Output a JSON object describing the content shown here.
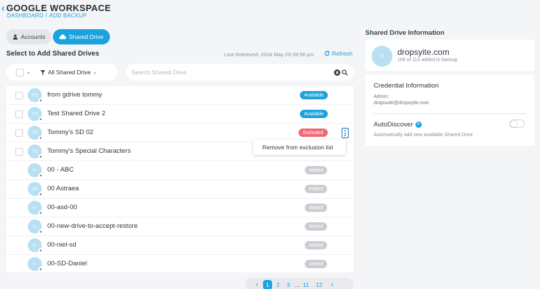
{
  "header": {
    "title": "GOOGLE WORKSPACE",
    "back_icon": "chevron-left-icon"
  },
  "breadcrumb": {
    "items": [
      "DASHBOARD",
      "ADD BACKUP"
    ],
    "separator": "/"
  },
  "tabs": [
    {
      "label": "Accounts",
      "icon": "person-icon",
      "active": false
    },
    {
      "label": "Shared Drive",
      "icon": "cloud-icon",
      "active": true
    }
  ],
  "main": {
    "section_title": "Select to Add Shared Drives",
    "last_retrieved": "Last Retrieved: 2024 May 29 08:58 pm",
    "refresh_label": "Refresh",
    "filter": {
      "label": "All Shared Drive"
    },
    "search": {
      "placeholder": "Search Shared Drive"
    }
  },
  "drives": [
    {
      "initials": "FG",
      "name": "from gdrive tommy",
      "status": "Available",
      "status_type": "available",
      "checkbox": true
    },
    {
      "initials": "TS",
      "name": "Test Shared Drive 2",
      "status": "Available",
      "status_type": "available",
      "checkbox": true
    },
    {
      "initials": "TS",
      "name": "Tommy's SD 02",
      "status": "Excluded",
      "status_type": "excluded",
      "checkbox": true
    },
    {
      "initials": "TS",
      "name": "Tommy's Special Characters",
      "status": "",
      "status_type": "",
      "checkbox": true
    },
    {
      "initials": "0-",
      "name": "00 - ABC",
      "status": "Added",
      "status_type": "added",
      "checkbox": false
    },
    {
      "initials": "0A",
      "name": "00 Astraea",
      "status": "Added",
      "status_type": "added",
      "checkbox": false
    },
    {
      "initials": "0-",
      "name": "00-asd-00",
      "status": "Added",
      "status_type": "added",
      "checkbox": false
    },
    {
      "initials": "0-",
      "name": "00-new-drive-to-accept-restore",
      "status": "Added",
      "status_type": "added",
      "checkbox": false
    },
    {
      "initials": "0-",
      "name": "00-niel-sd",
      "status": "Added",
      "status_type": "added",
      "checkbox": false
    },
    {
      "initials": "0-",
      "name": "00-SD-Daniel",
      "status": "Added",
      "status_type": "added",
      "checkbox": false
    }
  ],
  "popover": {
    "label": "Remove from exclusion list"
  },
  "pagination": {
    "prev": "‹",
    "pages": [
      "1",
      "2",
      "3",
      "...",
      "11",
      "12"
    ],
    "active": "1",
    "next": "›"
  },
  "panel": {
    "title": "Shared Drive Information",
    "avatar_initials": "D",
    "name": "dropsyite.com",
    "subtitle": "109 of 113 added to backup",
    "credential_title": "Credential Information",
    "admin_label": "Admin:",
    "admin_email": "dropsuite@dropsyite.com",
    "autodiscover_title": "AutoDiscover",
    "autodiscover_desc": "Automatically add new available Shared Drive",
    "autodiscover_on": false
  },
  "colors": {
    "accent": "#1ba3e0",
    "excluded": "#ef6a78",
    "added": "#c9ccd1"
  }
}
